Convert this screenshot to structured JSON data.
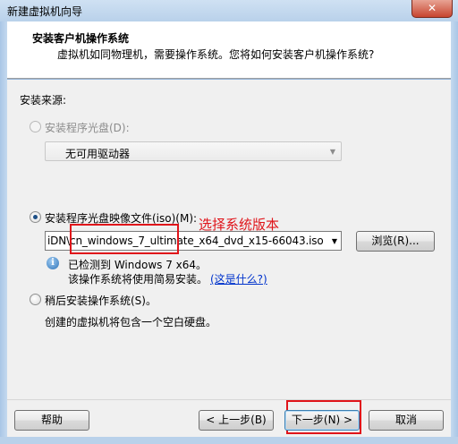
{
  "window": {
    "title": "新建虚拟机向导",
    "close_glyph": "✕"
  },
  "header": {
    "title": "安装客户机操作系统",
    "subtitle": "虚拟机如同物理机，需要操作系统。您将如何安装客户机操作系统?"
  },
  "source": {
    "section_label": "安装来源:",
    "disc_option": {
      "label": "安装程序光盘(D):",
      "selected": false,
      "enabled": false,
      "drive_value": "无可用驱动器"
    },
    "iso_option": {
      "label": "安装程序光盘映像文件(iso)(M):",
      "selected": true,
      "path_value": "iDN\\cn_windows_7_ultimate_x64_dvd_x15-66043.iso",
      "browse_label": "浏览(R)..."
    },
    "detection": {
      "line1": "已检测到 Windows 7 x64。",
      "line2": "该操作系统将使用简易安装。",
      "link_text": "(这是什么?)",
      "icon": "info-icon"
    },
    "later_option": {
      "label": "稍后安装操作系统(S)。",
      "selected": false,
      "description": "创建的虚拟机将包含一个空白硬盘。"
    }
  },
  "annotation": {
    "text": "选择系统版本",
    "color": "#e0141a"
  },
  "footer": {
    "help_label": "帮助",
    "back_label": "< 上一步(B)",
    "next_label": "下一步(N) >",
    "cancel_label": "取消"
  }
}
